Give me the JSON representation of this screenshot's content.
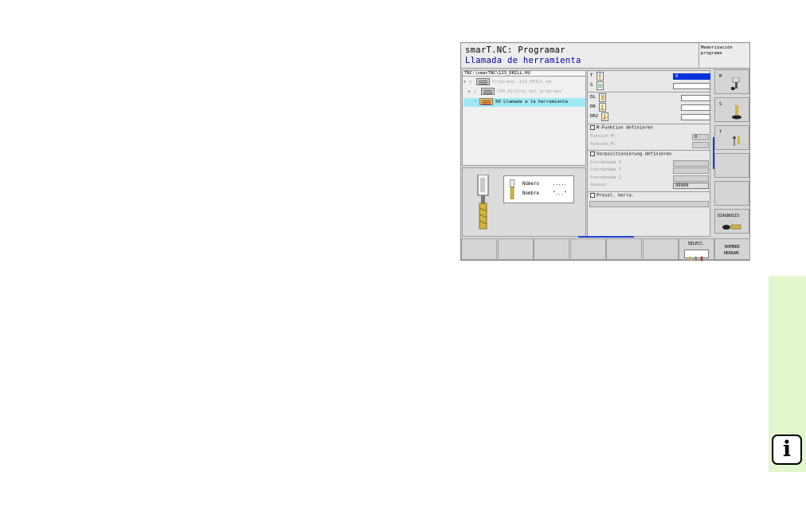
{
  "header": {
    "title_line1": "smarT.NC: Programar",
    "title_line2": "Llamada de herramienta",
    "mode": "Memorización\nprograma"
  },
  "tree": {
    "path": "TNC:\\smarTNC\\123_DRILL.HU",
    "items": [
      {
        "label": "Programa: 123_DRILL mm"
      },
      {
        "label": "700 Ajustes del programa"
      },
      {
        "label": "50 Llamada a la herramienta"
      }
    ]
  },
  "help": {
    "row1_label": "Número",
    "row1_value": ".....",
    "row2_label": "Nombre",
    "row2_value": "\"...\""
  },
  "form": {
    "t_label": "T",
    "t_value": "0",
    "s_label": "S",
    "dl_label": "DL",
    "dr_label": "DR",
    "dr2_label": "DR2",
    "m_check": "M-Funktion definieren",
    "m1_label": "Función M:",
    "m1_value": "0",
    "m2_label": "Función M:",
    "pre_check": "Vorpositionierung definieren",
    "cx_label": "Coordenada X",
    "cy_label": "Coordenada Y",
    "cz_label": "Coordenada Z",
    "feed_label": "Avance",
    "feed_value": "99999",
    "presel_check": "Presel. herra."
  },
  "softkeys": {
    "v1": "M",
    "v2": "S",
    "v3": "T",
    "diag": "DIAGNOSIS",
    "select": "SELECC.",
    "tool_name_1": "NOMBRE",
    "tool_name_2": "HERRAM."
  },
  "info_icon": "i",
  "colors": {
    "active_field": "#0033dd",
    "selected_row": "#9fe8f5",
    "sidebar": "#e3f6cd",
    "title_blue": "#0000aa"
  }
}
